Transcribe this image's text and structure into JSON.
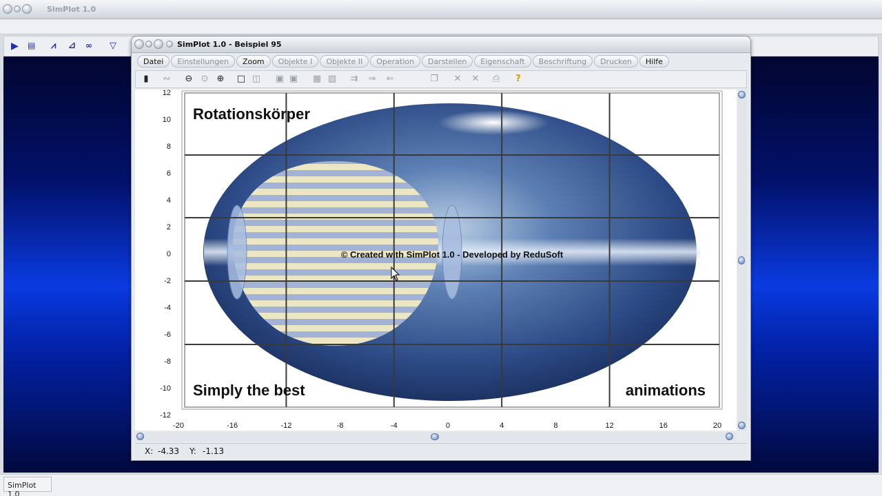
{
  "main_window": {
    "title": "SimPlot 1.0",
    "toolbar_icons": [
      "play-icon",
      "table-icon",
      "graph-icon",
      "graph-point-icon",
      "zero-graph-icon",
      "filter-icon"
    ]
  },
  "status": {
    "label": "SimPlot 1.0"
  },
  "child_window": {
    "title": "SimPlot 1.0 - Beispiel 95",
    "menu": [
      {
        "label": "Datei",
        "active": true
      },
      {
        "label": "Einstellungen",
        "active": false
      },
      {
        "label": "Zoom",
        "active": true
      },
      {
        "label": "Objekte I",
        "active": false
      },
      {
        "label": "Objekte II",
        "active": false
      },
      {
        "label": "Operation",
        "active": false
      },
      {
        "label": "Darstellen",
        "active": false
      },
      {
        "label": "Eigenschaft",
        "active": false
      },
      {
        "label": "Beschriftung",
        "active": false
      },
      {
        "label": "Drucken",
        "active": false
      },
      {
        "label": "Hilfe",
        "active": true
      }
    ],
    "tool_icons": [
      "calculator-icon",
      "link-icon",
      "zoom-out-icon",
      "zoom-icon",
      "zoom-in-icon",
      "square-icon",
      "dual-square-icon",
      "copy-a-icon",
      "copy-b-icon",
      "table-icon",
      "table-edit-icon",
      "move-icon",
      "arrow-right-icon",
      "arrow-left-icon",
      "copy-icon",
      "cross-icon",
      "cross2-icon",
      "print-icon",
      "help-icon"
    ]
  },
  "plot": {
    "title": "Rotationskörper",
    "bottom_left_text": "Simply the best",
    "bottom_right_text": "animations",
    "watermark": "© Created with SimPlot 1.0 - Developed by ReduSoft",
    "x_ticks": [
      "-20",
      "-16",
      "-12",
      "-8",
      "-4",
      "0",
      "4",
      "8",
      "12",
      "16",
      "20"
    ],
    "y_ticks": [
      "12",
      "10",
      "8",
      "6",
      "4",
      "2",
      "0",
      "-2",
      "-4",
      "-6",
      "-8",
      "-10",
      "-12"
    ],
    "xlim": [
      -20,
      20
    ],
    "ylim": [
      -12,
      12
    ]
  },
  "coords": {
    "x_label": "X:",
    "x_value": "-4.33",
    "y_label": "Y:",
    "y_value": "-1.13"
  }
}
